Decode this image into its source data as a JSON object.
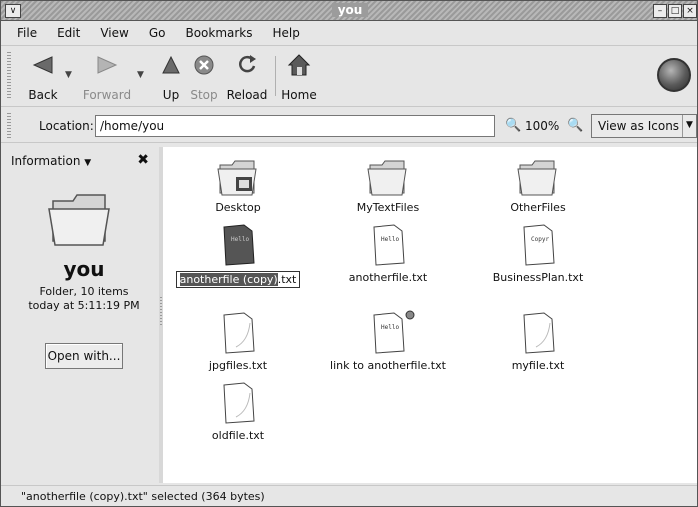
{
  "window": {
    "title": "you"
  },
  "menubar": {
    "items": [
      {
        "label": "File"
      },
      {
        "label": "Edit"
      },
      {
        "label": "View"
      },
      {
        "label": "Go"
      },
      {
        "label": "Bookmarks"
      },
      {
        "label": "Help"
      }
    ]
  },
  "toolbar": {
    "back": {
      "label": "Back",
      "icon": "back-arrow-icon"
    },
    "forward": {
      "label": "Forward",
      "icon": "forward-arrow-icon",
      "enabled": false
    },
    "up": {
      "label": "Up",
      "icon": "up-arrow-icon"
    },
    "stop": {
      "label": "Stop",
      "icon": "stop-icon",
      "enabled": false
    },
    "reload": {
      "label": "Reload",
      "icon": "reload-icon"
    },
    "home": {
      "label": "Home",
      "icon": "home-icon"
    }
  },
  "location": {
    "label": "Location:",
    "value": "/home/you",
    "zoom": "100%",
    "view_mode": "View as Icons"
  },
  "sidepanel": {
    "title": "Information",
    "folder_name": "you",
    "info_line1": "Folder, 10 items",
    "info_line2": "today at 5:11:19 PM",
    "open_with": "Open with..."
  },
  "files": [
    {
      "name": "Desktop",
      "type": "folder"
    },
    {
      "name": "MyTextFiles",
      "type": "folder"
    },
    {
      "name": "OtherFiles",
      "type": "folder"
    },
    {
      "name_selected": "anotherfile (copy)",
      "name_ext": ".txt",
      "type": "text",
      "selected": true
    },
    {
      "name": "anotherfile.txt",
      "type": "text"
    },
    {
      "name": "BusinessPlan.txt",
      "type": "text"
    },
    {
      "name": "jpgfiles.txt",
      "type": "text"
    },
    {
      "name": "link to anotherfile.txt",
      "type": "link"
    },
    {
      "name": "myfile.txt",
      "type": "text"
    },
    {
      "name": "oldfile.txt",
      "type": "text"
    }
  ],
  "status": {
    "text": "\"anotherfile (copy).txt\" selected (364 bytes)"
  }
}
